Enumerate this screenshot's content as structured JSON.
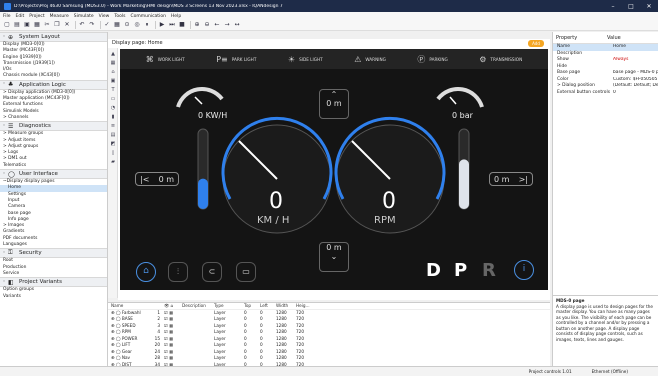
{
  "window": {
    "title": "D:\\Projects\\Proj 4630 Samsung (MDS3.0) - Work Marketing\\HMI design\\MDS 3 Screens 13 Nov 2023.xlsx - IQANdesign 7",
    "min": "–",
    "max": "□",
    "close": "✕"
  },
  "menu": [
    "File",
    "Edit",
    "Project",
    "Measure",
    "Simulate",
    "View",
    "Tools",
    "Communication",
    "Help"
  ],
  "sidebar": {
    "sections": [
      {
        "title": "System Layout",
        "icon": "⊕",
        "items": [
          {
            "label": "Display (MD3-0[0])"
          },
          {
            "label": "Master (MC43F[0])"
          },
          {
            "label": "Engine (J1939[0])"
          },
          {
            "label": "Transmission (J1939[1])"
          },
          {
            "label": "I/Os"
          },
          {
            "label": "Chassis module (XC43[0])"
          }
        ]
      },
      {
        "title": "Application Logic",
        "icon": "♣",
        "items": [
          {
            "label": "> Display application (MD3-0[0])"
          },
          {
            "label": "Master application (MC43F[0])"
          },
          {
            "label": "External functions"
          },
          {
            "label": "Simulink Models"
          },
          {
            "label": "> Channels"
          }
        ]
      },
      {
        "title": "Diagnostics",
        "icon": "☰",
        "items": [
          {
            "label": "> Measure groups"
          },
          {
            "label": "> Adjust items"
          },
          {
            "label": "> Adjust groups"
          },
          {
            "label": "> Logs"
          },
          {
            "label": "> DM1 out"
          },
          {
            "label": "Telematics"
          }
        ]
      },
      {
        "title": "User Interface",
        "icon": "◯",
        "items": [
          {
            "label": "~Display display pages"
          },
          {
            "label": "Home",
            "sub": true,
            "selected": true
          },
          {
            "label": "Settings",
            "sub": true
          },
          {
            "label": "Input",
            "sub": true
          },
          {
            "label": "Camera",
            "sub": true
          },
          {
            "label": "base page",
            "sub": true
          },
          {
            "label": "Info page",
            "sub": true
          },
          {
            "label": "> Images"
          },
          {
            "label": "Gradients"
          },
          {
            "label": "PDF documents"
          },
          {
            "label": "Languages"
          }
        ]
      },
      {
        "title": "Security",
        "icon": "⚿",
        "items": [
          {
            "label": "Root"
          },
          {
            "label": "Production"
          },
          {
            "label": "Service"
          }
        ]
      },
      {
        "title": "Project Variants",
        "icon": "◧",
        "items": [
          {
            "label": "Option groups"
          },
          {
            "label": "Variants"
          }
        ]
      }
    ]
  },
  "canvas": {
    "header": "Display page: Home",
    "badge": "Add",
    "warning_lights": [
      {
        "glyph": "⌘",
        "label": "WORK LIGHT"
      },
      {
        "glyph": "P≡",
        "label": "PARK LIGHT"
      },
      {
        "glyph": "☀",
        "label": "SIDE LIGHT"
      },
      {
        "glyph": "⚠",
        "label": "WARNING"
      },
      {
        "glyph": "Ⓟ",
        "label": "PARKING"
      },
      {
        "glyph": "⚙",
        "label": "TRANSMISSION"
      }
    ],
    "left_small_value": "0 KW/H",
    "right_small_value": "0 bar",
    "top_center_value": "0 m",
    "bottom_center_value": "0 m",
    "left_box": "0 m",
    "right_box": "0 m",
    "speed_value": "0",
    "speed_unit": "KM / H",
    "rpm_value": "0",
    "rpm_unit": "RPM",
    "gears": {
      "d": "D",
      "p": "P",
      "r": "R"
    },
    "info_icon": "i",
    "left_fill_level": 0.38,
    "right_fill_level": 0.62,
    "accent_color": "#4a90e2"
  },
  "properties": {
    "col_property": "Property",
    "col_value": "Value",
    "rows": [
      {
        "k": "Name",
        "v": "Home",
        "sel": true
      },
      {
        "k": "Description",
        "v": ""
      },
      {
        "k": "Show",
        "v": "Always",
        "red": true
      },
      {
        "k": "Hide",
        "v": ""
      },
      {
        "k": "Base page",
        "v": "base page - MDS-0 p"
      },
      {
        "k": "Color",
        "v": "Custom: $FF050505"
      },
      {
        "k": "> Dialog position",
        "v": "(Default: Default; Defau"
      },
      {
        "k": "External button controls",
        "v": "0"
      }
    ],
    "help_title": "MDS-0 page",
    "help_text": "A display page is used to design pages for the master display. You can have as many pages as you like. The visibility of each page can be controlled by a channel and/or by pressing a button on another page. A display page consists of display page controls, such as images, texts, lines and gauges."
  },
  "layers": {
    "headers": [
      "Name",
      "",
      "Description",
      "Type",
      "Top",
      "Left",
      "Width",
      "Heig..."
    ],
    "rows": [
      {
        "name": "Farbwahl",
        "n": "1",
        "type": "Layer",
        "top": "0",
        "left": "0",
        "w": "1280",
        "h": "720"
      },
      {
        "name": "BASE",
        "n": "2",
        "type": "Layer",
        "top": "0",
        "left": "0",
        "w": "1280",
        "h": "720"
      },
      {
        "name": "SPEED",
        "n": "3",
        "type": "Layer",
        "top": "0",
        "left": "0",
        "w": "1280",
        "h": "720"
      },
      {
        "name": "RPM",
        "n": "4",
        "type": "Layer",
        "top": "0",
        "left": "0",
        "w": "1280",
        "h": "720"
      },
      {
        "name": "POWER",
        "n": "15",
        "type": "Layer",
        "top": "0",
        "left": "0",
        "w": "1280",
        "h": "720"
      },
      {
        "name": "LIFT",
        "n": "20",
        "type": "Layer",
        "top": "0",
        "left": "0",
        "w": "1280",
        "h": "720"
      },
      {
        "name": "Gear",
        "n": "24",
        "type": "Layer",
        "top": "0",
        "left": "0",
        "w": "1280",
        "h": "720"
      },
      {
        "name": "Nav",
        "n": "28",
        "type": "Layer",
        "top": "0",
        "left": "0",
        "w": "1280",
        "h": "720"
      },
      {
        "name": "DIST",
        "n": "34",
        "type": "Layer",
        "top": "0",
        "left": "0",
        "w": "1280",
        "h": "720"
      }
    ]
  },
  "status": {
    "left": "Project controls 1.01",
    "right": "Ethernet (Offline)"
  }
}
